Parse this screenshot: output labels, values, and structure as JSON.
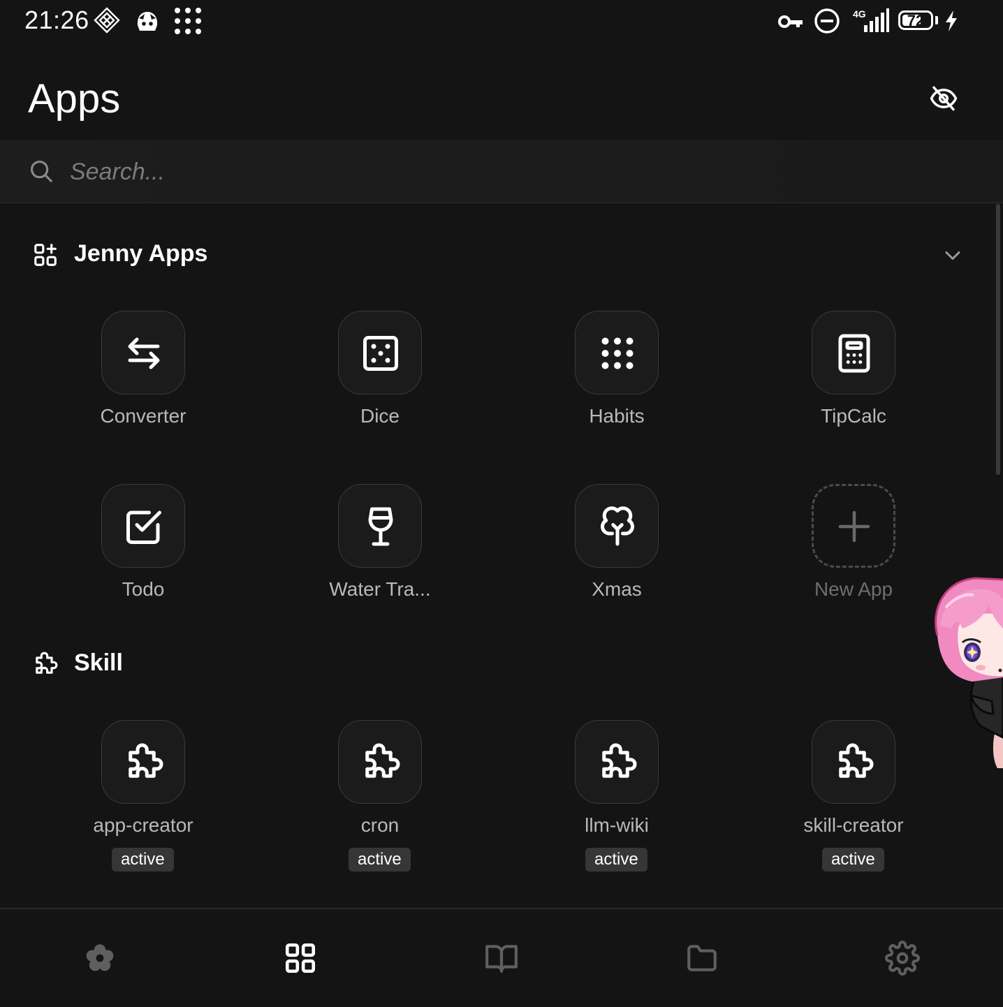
{
  "status_bar": {
    "time": "21:26",
    "battery": "72",
    "battery_level": 0.72,
    "network": "4G",
    "icons": [
      "diamond-icon",
      "mascot-notification-icon",
      "dots-grid-icon",
      "vpn-key-icon",
      "do-not-disturb-icon",
      "signal-icon",
      "battery-icon",
      "charging-icon"
    ]
  },
  "header": {
    "title": "Apps",
    "action_icon": "eye-off-icon"
  },
  "search": {
    "placeholder": "Search...",
    "value": ""
  },
  "sections": {
    "jenny": {
      "title": "Jenny Apps",
      "icon": "apps-grid-plus-icon",
      "collapse_icon": "chevron-down-icon",
      "apps": [
        {
          "label": "Converter",
          "icon": "arrows-left-right-icon"
        },
        {
          "label": "Dice",
          "icon": "dice-icon"
        },
        {
          "label": "Habits",
          "icon": "dots-grid-icon"
        },
        {
          "label": "TipCalc",
          "icon": "calculator-icon"
        },
        {
          "label": "Todo",
          "icon": "checkbox-icon"
        },
        {
          "label": "Water Tra...",
          "icon": "wine-glass-icon"
        },
        {
          "label": "Xmas",
          "icon": "tree-icon"
        },
        {
          "label": "New App",
          "icon": "plus-icon"
        }
      ]
    },
    "skill": {
      "title": "Skill",
      "icon": "puzzle-icon",
      "items": [
        {
          "label": "app-creator",
          "status": "active"
        },
        {
          "label": "cron",
          "status": "active"
        },
        {
          "label": "llm-wiki",
          "status": "active"
        },
        {
          "label": "skill-creator",
          "status": "active"
        }
      ]
    }
  },
  "bottom_nav": {
    "items": [
      "flower-icon",
      "apps-icon",
      "book-icon",
      "folder-icon",
      "settings-icon"
    ],
    "active_index": 1
  },
  "colors": {
    "background": "#141414",
    "tile_border": "#3b3b3b",
    "badge_bg": "#363636",
    "label": "#b9b9b9",
    "mascot_hair": "#f08ac0"
  }
}
